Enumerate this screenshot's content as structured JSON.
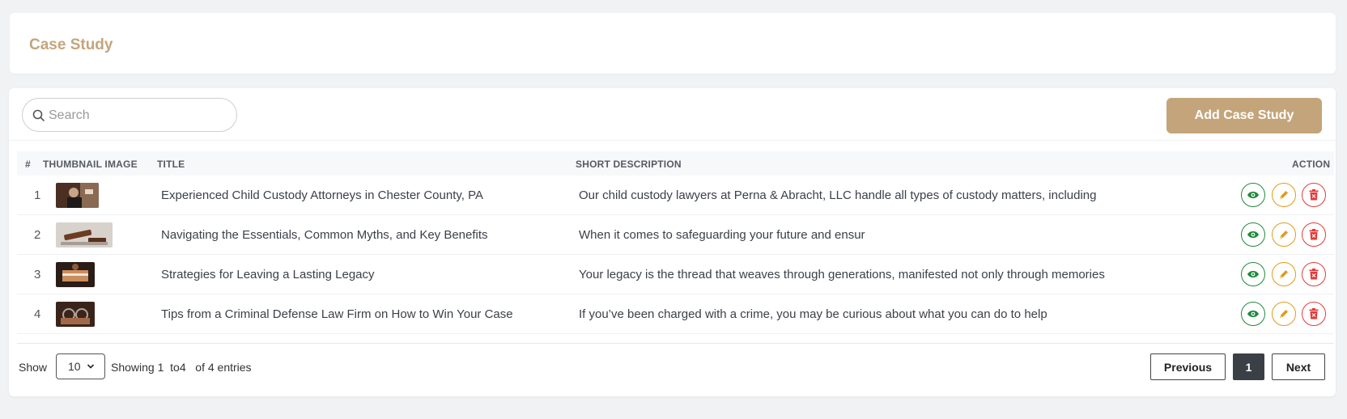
{
  "header": {
    "title": "Case Study"
  },
  "toolbar": {
    "search_placeholder": "Search",
    "add_button_label": "Add Case Study"
  },
  "table": {
    "columns": {
      "num": "#",
      "thumbnail": "THUMBNAIL IMAGE",
      "title": "TITLE",
      "short_description": "SHORT DESCRIPTION",
      "action": "ACTION"
    },
    "rows": [
      {
        "num": "1",
        "title": "Experienced Child Custody Attorneys in Chester County, PA",
        "description": "Our child custody lawyers at Perna & Abracht, LLC handle all types of custody matters, including"
      },
      {
        "num": "2",
        "title": "Navigating the Essentials, Common Myths, and Key Benefits",
        "description": "When it comes to safeguarding your future and ensur"
      },
      {
        "num": "3",
        "title": "Strategies for Leaving a Lasting Legacy",
        "description": "Your legacy is the thread that weaves through generations, manifested not only through memories"
      },
      {
        "num": "4",
        "title": "Tips from a Criminal Defense Law Firm on How to Win Your Case",
        "description": "If you’ve been charged with a crime, you may be curious about what you can do to help"
      }
    ]
  },
  "footer": {
    "show_label": "Show",
    "page_size": "10",
    "entries_info": "Showing 1  to4   of 4 entries",
    "prev_label": "Previous",
    "current_page": "1",
    "next_label": "Next"
  },
  "colors": {
    "accent": "#c4a57b",
    "view": "#1f8a3c",
    "edit": "#e19a1a",
    "delete": "#e23b3b"
  }
}
